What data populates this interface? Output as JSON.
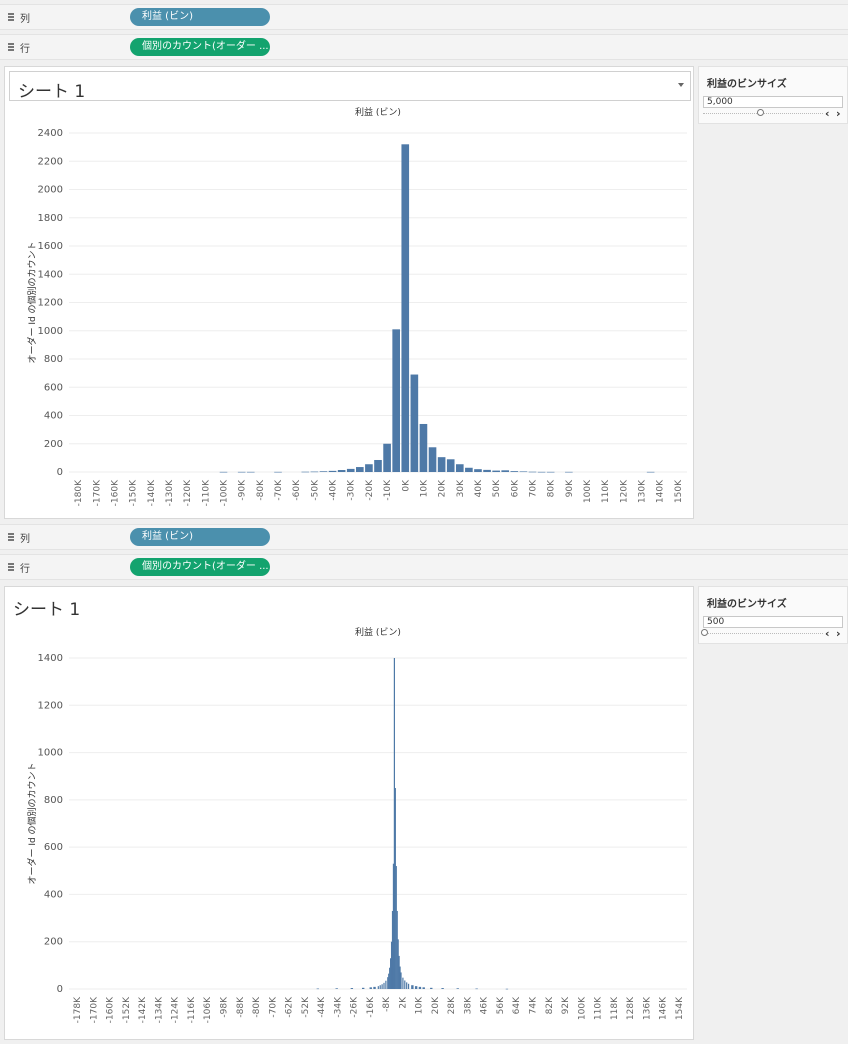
{
  "top": {
    "columns_shelf": {
      "label": "列",
      "pill": "利益 (ビン)"
    },
    "rows_shelf": {
      "label": "行",
      "pill": "個別のカウント(オーダー ..."
    },
    "sheet_title": "シート 1",
    "parameter": {
      "title": "利益のビンサイズ",
      "value": "5,000",
      "slider_fraction": 0.5
    },
    "chart_data": {
      "type": "bar",
      "title": "利益 (ビン)",
      "xlabel": "",
      "ylabel": "オーダー Id の個別のカウント",
      "ylim": [
        0,
        2400
      ],
      "yticks": [
        0,
        200,
        400,
        600,
        800,
        1000,
        1200,
        1400,
        1600,
        1800,
        2000,
        2200,
        2400
      ],
      "grid": true,
      "xtick_labels": [
        "-180K",
        "-170K",
        "-160K",
        "-150K",
        "-140K",
        "-130K",
        "-120K",
        "-110K",
        "-100K",
        "-90K",
        "-80K",
        "-70K",
        "-60K",
        "-50K",
        "-40K",
        "-30K",
        "-20K",
        "-10K",
        "0K",
        "10K",
        "20K",
        "30K",
        "40K",
        "50K",
        "60K",
        "70K",
        "80K",
        "90K",
        "100K",
        "110K",
        "120K",
        "130K",
        "140K",
        "150K"
      ],
      "categories": [
        -100,
        -90,
        -85,
        -70,
        -55,
        -50,
        -45,
        -40,
        -35,
        -30,
        -25,
        -20,
        -15,
        -10,
        -5,
        0,
        5,
        10,
        15,
        20,
        25,
        30,
        35,
        40,
        45,
        50,
        55,
        60,
        65,
        70,
        75,
        80,
        90,
        135
      ],
      "values": [
        1,
        1,
        1,
        1,
        2,
        3,
        5,
        8,
        14,
        22,
        35,
        55,
        85,
        200,
        1010,
        2320,
        690,
        340,
        175,
        105,
        90,
        55,
        30,
        20,
        15,
        10,
        12,
        6,
        4,
        2,
        1,
        1,
        1,
        1
      ],
      "color": "#4e79a7"
    }
  },
  "bottom": {
    "columns_shelf": {
      "label": "列",
      "pill": "利益 (ビン)"
    },
    "rows_shelf": {
      "label": "行",
      "pill": "個別のカウント(オーダー ..."
    },
    "sheet_title": "シート 1",
    "parameter": {
      "title": "利益のビンサイズ",
      "value": "500",
      "slider_fraction": 0.0
    },
    "chart_data": {
      "type": "bar",
      "title": "利益 (ビン)",
      "xlabel": "",
      "ylabel": "オーダー Id の個別のカウント",
      "ylim": [
        0,
        1400
      ],
      "yticks": [
        0,
        200,
        400,
        600,
        800,
        1000,
        1200,
        1400
      ],
      "grid": true,
      "xtick_labels": [
        "-178K",
        "-170K",
        "-160K",
        "-152K",
        "-142K",
        "-134K",
        "-124K",
        "-116K",
        "-106K",
        "-98K",
        "-88K",
        "-80K",
        "-70K",
        "-62K",
        "-52K",
        "-44K",
        "-34K",
        "-26K",
        "-16K",
        "-8K",
        "2K",
        "10K",
        "20K",
        "28K",
        "38K",
        "46K",
        "56K",
        "64K",
        "74K",
        "82K",
        "92K",
        "100K",
        "110K",
        "118K",
        "128K",
        "136K",
        "146K",
        "154K"
      ],
      "categories": [
        -40,
        -30,
        -22,
        -16,
        -12,
        -10,
        -8,
        -7,
        -6,
        -5,
        -4,
        -3,
        -2.5,
        -2,
        -1.5,
        -1,
        -0.5,
        0,
        0.5,
        1,
        1.5,
        2,
        2.5,
        3,
        3.5,
        4,
        5,
        6,
        7,
        8,
        10,
        12,
        14,
        16,
        20,
        26,
        34,
        44,
        60
      ],
      "values": [
        2,
        3,
        4,
        5,
        7,
        9,
        12,
        16,
        20,
        26,
        35,
        50,
        65,
        90,
        130,
        200,
        330,
        530,
        1400,
        850,
        520,
        330,
        210,
        140,
        95,
        70,
        48,
        36,
        28,
        22,
        16,
        12,
        9,
        7,
        5,
        4,
        3,
        2,
        1
      ],
      "color": "#4e79a7"
    }
  }
}
